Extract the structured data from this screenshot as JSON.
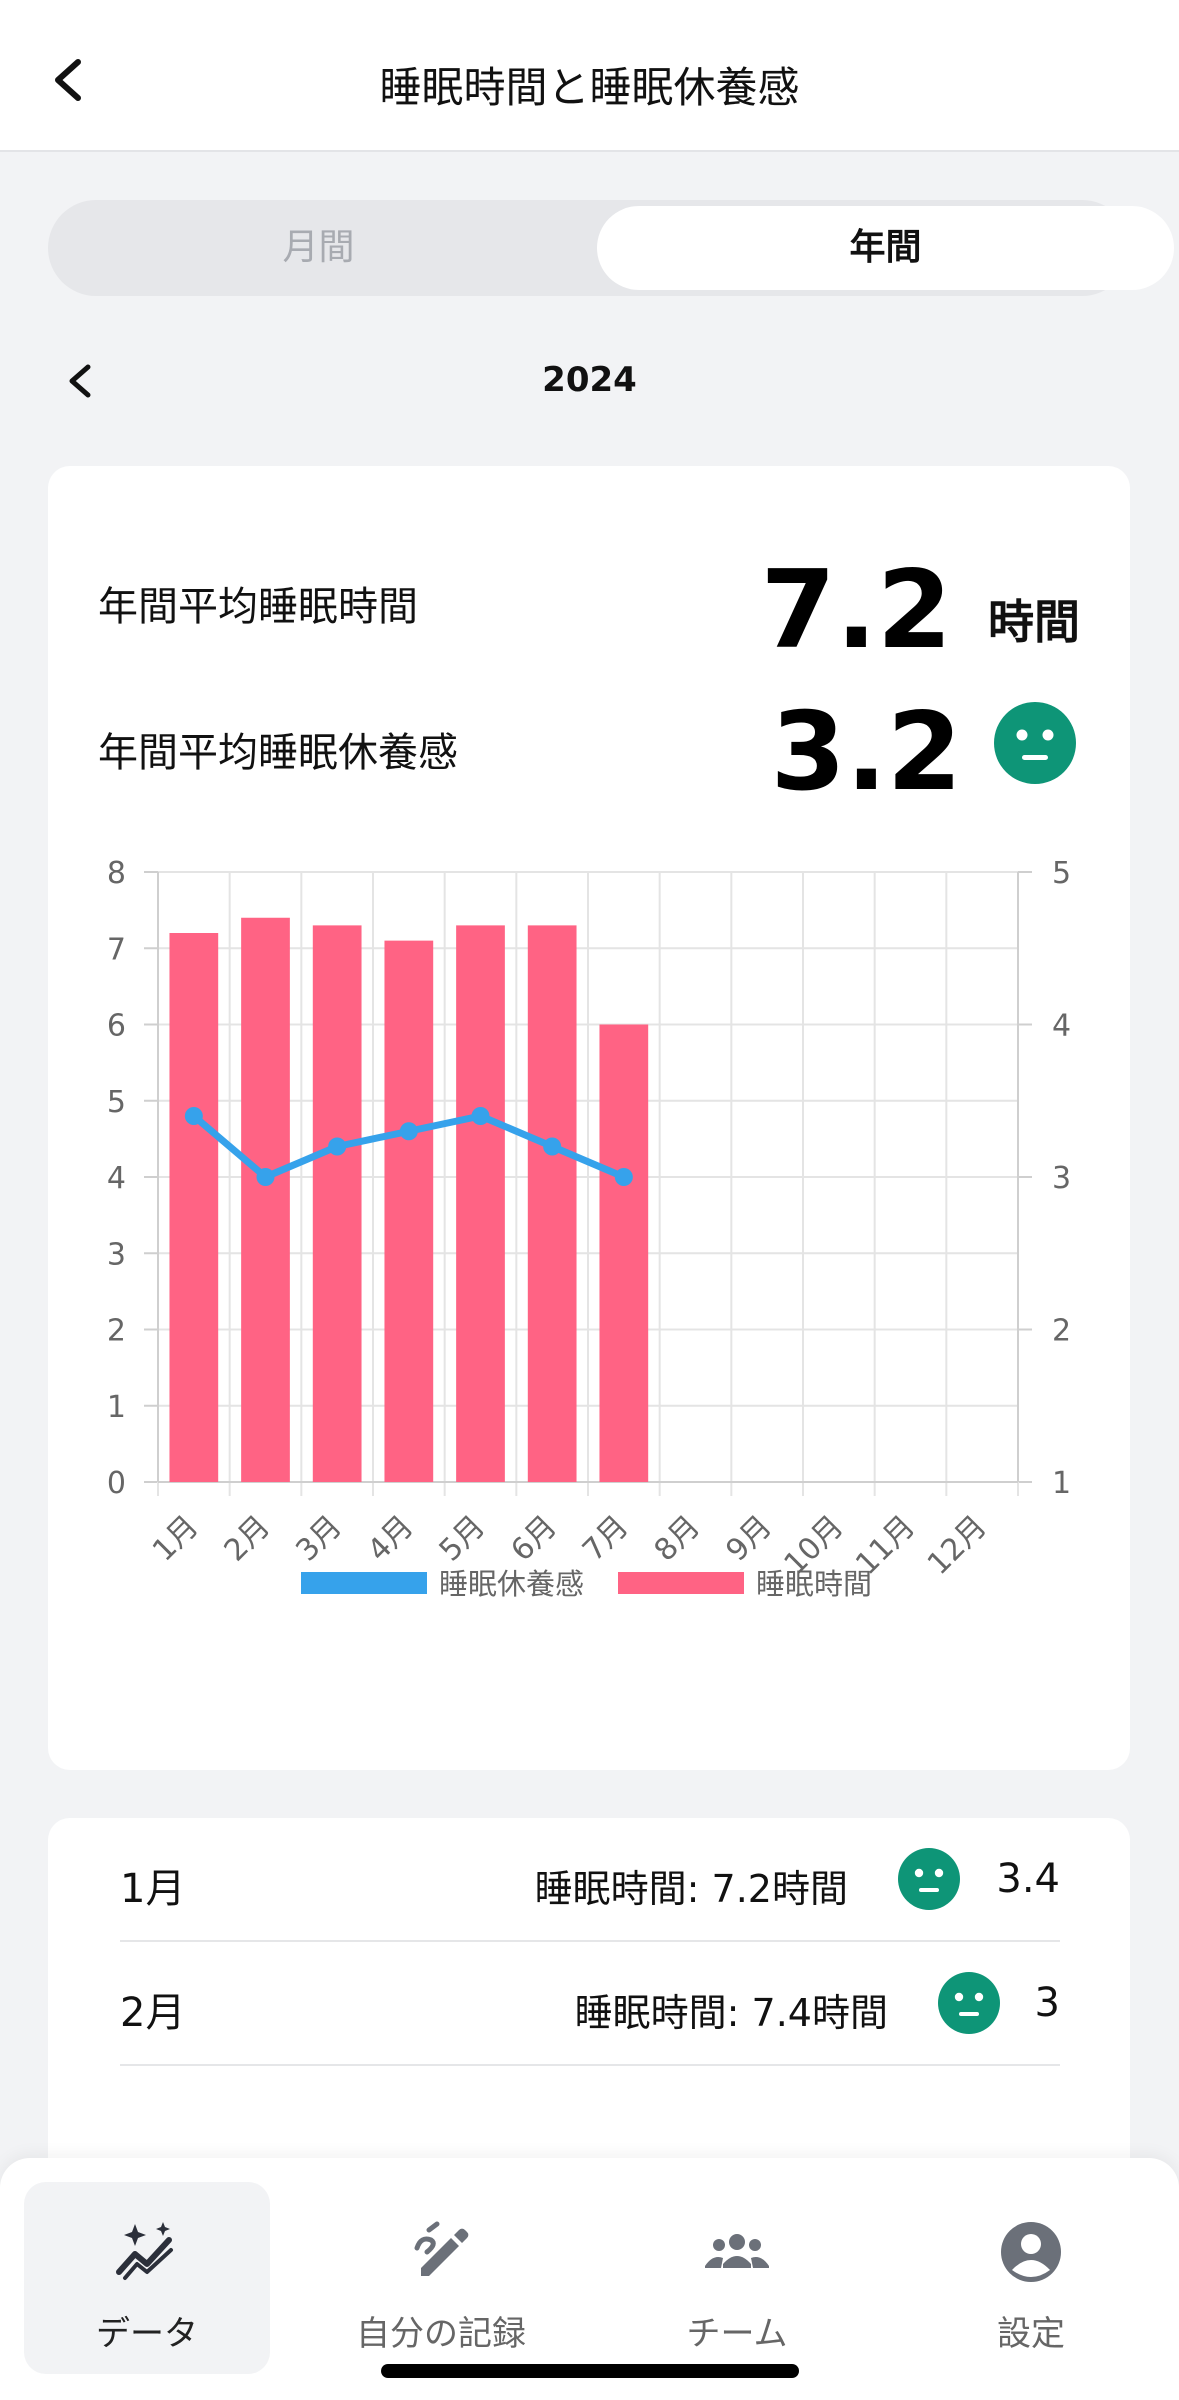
{
  "header": {
    "title": "睡眠時間と睡眠休養感"
  },
  "period_tabs": {
    "monthly": "月間",
    "yearly": "年間",
    "selected": "年間"
  },
  "year_nav": {
    "year": "2024"
  },
  "summary": {
    "avg_sleep_label": "年間平均睡眠時間",
    "avg_sleep_value": "7.2",
    "avg_sleep_unit": "時間",
    "avg_rest_label": "年間平均睡眠休養感",
    "avg_rest_value": "3.2",
    "avg_rest_icon": "neutral-face-icon"
  },
  "colors": {
    "bar": "#ff6384",
    "line": "#36a2eb",
    "face": "#0e9577"
  },
  "chart_data": {
    "type": "bar",
    "categories": [
      "1月",
      "2月",
      "3月",
      "4月",
      "5月",
      "6月",
      "7月",
      "8月",
      "9月",
      "10月",
      "11月",
      "12月"
    ],
    "series": [
      {
        "name": "睡眠時間",
        "type": "bar",
        "axis": "left",
        "values": [
          7.2,
          7.4,
          7.3,
          7.1,
          7.3,
          7.3,
          6.0,
          null,
          null,
          null,
          null,
          null
        ]
      },
      {
        "name": "睡眠休養感",
        "type": "line",
        "axis": "right",
        "values": [
          3.4,
          3.0,
          3.2,
          3.3,
          3.4,
          3.2,
          3.0,
          null,
          null,
          null,
          null,
          null
        ]
      }
    ],
    "y_left": {
      "min": 0,
      "max": 8,
      "ticks": [
        0,
        1,
        2,
        3,
        4,
        5,
        6,
        7,
        8
      ]
    },
    "y_right": {
      "min": 1,
      "max": 5,
      "ticks": [
        1,
        2,
        3,
        4,
        5
      ]
    },
    "grid": true,
    "legend_position": "bottom",
    "legend": [
      "睡眠休養感",
      "睡眠時間"
    ]
  },
  "monthly_list": [
    {
      "month": "1月",
      "detail": "睡眠時間: 7.2時間",
      "icon": "neutral-face-icon",
      "score": "3.4"
    },
    {
      "month": "2月",
      "detail": "睡眠時間: 7.4時間",
      "icon": "neutral-face-icon",
      "score": "3"
    }
  ],
  "tabbar": {
    "items": [
      {
        "label": "データ",
        "icon": "sparkle-chart-icon",
        "active": true
      },
      {
        "label": "自分の記録",
        "icon": "edit-pencil-icon",
        "active": false
      },
      {
        "label": "チーム",
        "icon": "group-icon",
        "active": false
      },
      {
        "label": "設定",
        "icon": "account-circle-icon",
        "active": false
      }
    ]
  }
}
